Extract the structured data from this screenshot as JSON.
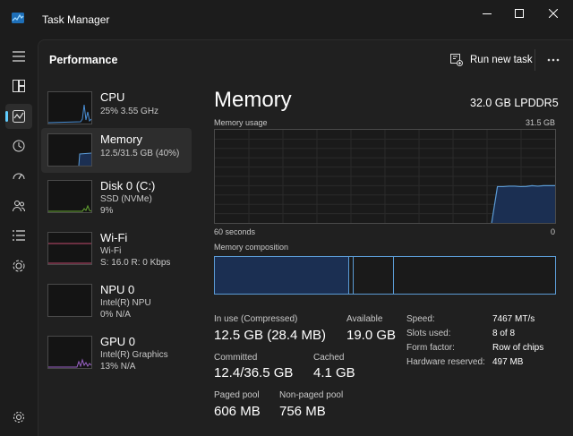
{
  "window": {
    "title": "Task Manager"
  },
  "header": {
    "title": "Performance",
    "run_new_task": "Run new task"
  },
  "devices": [
    {
      "name": "CPU",
      "line1": "25%  3.55 GHz",
      "line2": ""
    },
    {
      "name": "Memory",
      "line1": "12.5/31.5 GB (40%)",
      "line2": ""
    },
    {
      "name": "Disk 0 (C:)",
      "line1": "SSD (NVMe)",
      "line2": "9%"
    },
    {
      "name": "Wi-Fi",
      "line1": "Wi-Fi",
      "line2": "S: 16.0  R: 0 Kbps"
    },
    {
      "name": "NPU 0",
      "line1": "Intel(R) NPU",
      "line2": "0%  N/A"
    },
    {
      "name": "GPU 0",
      "line1": "Intel(R) Graphics",
      "line2": "13%  N/A"
    }
  ],
  "memory": {
    "title": "Memory",
    "spec": "32.0 GB LPDDR5",
    "usage_label": "Memory usage",
    "usage_max": "31.5 GB",
    "time_left": "60 seconds",
    "time_right": "0",
    "composition_label": "Memory composition",
    "usage_history": [
      0,
      0,
      0,
      0,
      0,
      0,
      0,
      0,
      0,
      0,
      0,
      0,
      0,
      0,
      0,
      0,
      0,
      0,
      0,
      0,
      0,
      0,
      0,
      0,
      0,
      0,
      0,
      0,
      0,
      0,
      0,
      0,
      0,
      0,
      0,
      0,
      0,
      0,
      0,
      0,
      0,
      0,
      0,
      0,
      0,
      0,
      0,
      0,
      0,
      0.39,
      0.39,
      0.395,
      0.395,
      0.39,
      0.392,
      0.4,
      0.395,
      0.4,
      0.4,
      0.4
    ],
    "composition_gb": {
      "in_use": 12.5,
      "modified": 0.4,
      "standby": 3.7,
      "free": 15.0
    },
    "stats": {
      "in_use_label": "In use (Compressed)",
      "in_use_value": "12.5 GB (28.4 MB)",
      "available_label": "Available",
      "available_value": "19.0 GB",
      "committed_label": "Committed",
      "committed_value": "12.4/36.5 GB",
      "cached_label": "Cached",
      "cached_value": "4.1 GB",
      "paged_label": "Paged pool",
      "paged_value": "606 MB",
      "nonpaged_label": "Non-paged pool",
      "nonpaged_value": "756 MB"
    },
    "details": [
      {
        "label": "Speed:",
        "value": "7467 MT/s"
      },
      {
        "label": "Slots used:",
        "value": "8 of 8"
      },
      {
        "label": "Form factor:",
        "value": "Row of chips"
      },
      {
        "label": "Hardware reserved:",
        "value": "497 MB"
      }
    ]
  },
  "colors": {
    "accent": "#60cdff",
    "cpu": "#4a8fd6",
    "memory_fill": "#1b2f52",
    "memory_line": "#5b9bd5",
    "disk": "#66a832",
    "wifi": "#c24a6e",
    "gpu": "#9a62c6"
  },
  "icons": [
    "task-manager-icon",
    "hamburger-icon",
    "processes-icon",
    "performance-icon",
    "app-history-icon",
    "startup-icon",
    "users-icon",
    "details-icon",
    "services-icon",
    "settings-icon",
    "run-task-icon",
    "more-icon"
  ]
}
